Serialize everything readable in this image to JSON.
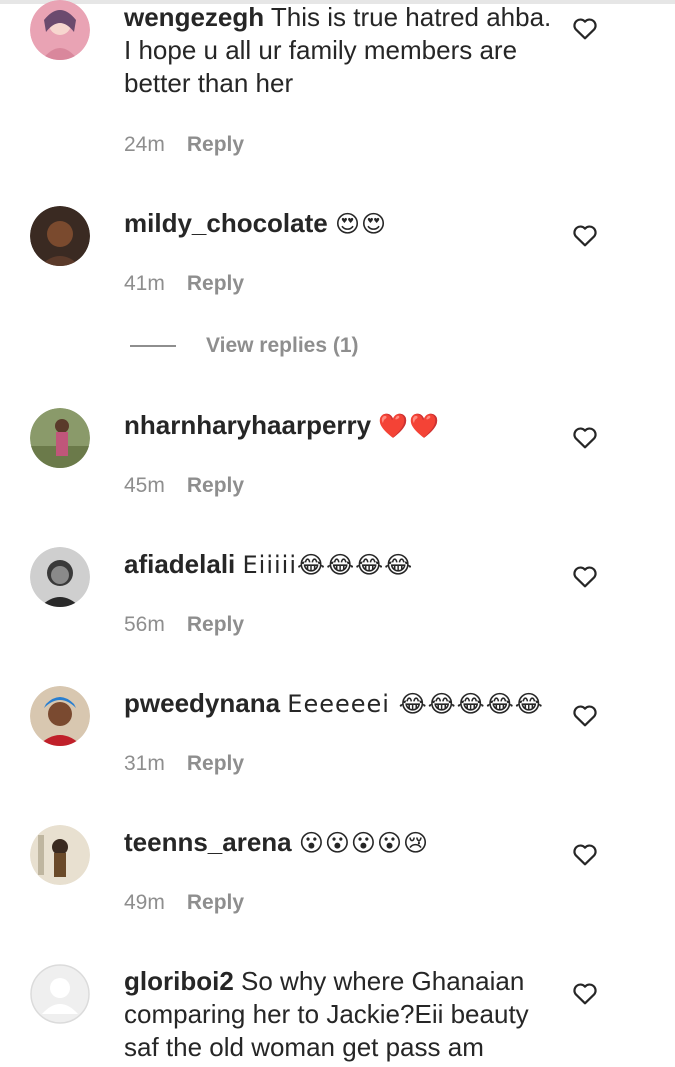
{
  "comments": [
    {
      "username": "wengezegh",
      "text": "This is true hatred ahba. I hope u all ur family members are better than her",
      "time": "24m",
      "reply": "Reply"
    },
    {
      "username": "mildy_chocolate",
      "text": "😍😍",
      "time": "41m",
      "reply": "Reply"
    },
    {
      "username": "nharnharyhaarperry",
      "text": "❤️❤️",
      "time": "45m",
      "reply": "Reply"
    },
    {
      "username": "afiadelali",
      "text": "Eiiiii😂😂😂😂",
      "time": "56m",
      "reply": "Reply"
    },
    {
      "username": "pweedynana",
      "text": "Eeeeeei 😂😂😂😂😂",
      "time": "31m",
      "reply": "Reply"
    },
    {
      "username": "teenns_arena",
      "text": "😮😮😮😮😢",
      "time": "49m",
      "reply": "Reply"
    },
    {
      "username": "gloriboi2",
      "text": "So why where Ghanaian comparing her to Jackie?Eii beauty saf the old woman get pass am",
      "time": "",
      "reply": ""
    }
  ],
  "view_replies": "View replies (1)",
  "icons": {
    "like": "heart-outline-icon",
    "default_avatar": "default-avatar-icon"
  },
  "colors": {
    "text": "#262626",
    "secondary": "#8e8e8e"
  }
}
